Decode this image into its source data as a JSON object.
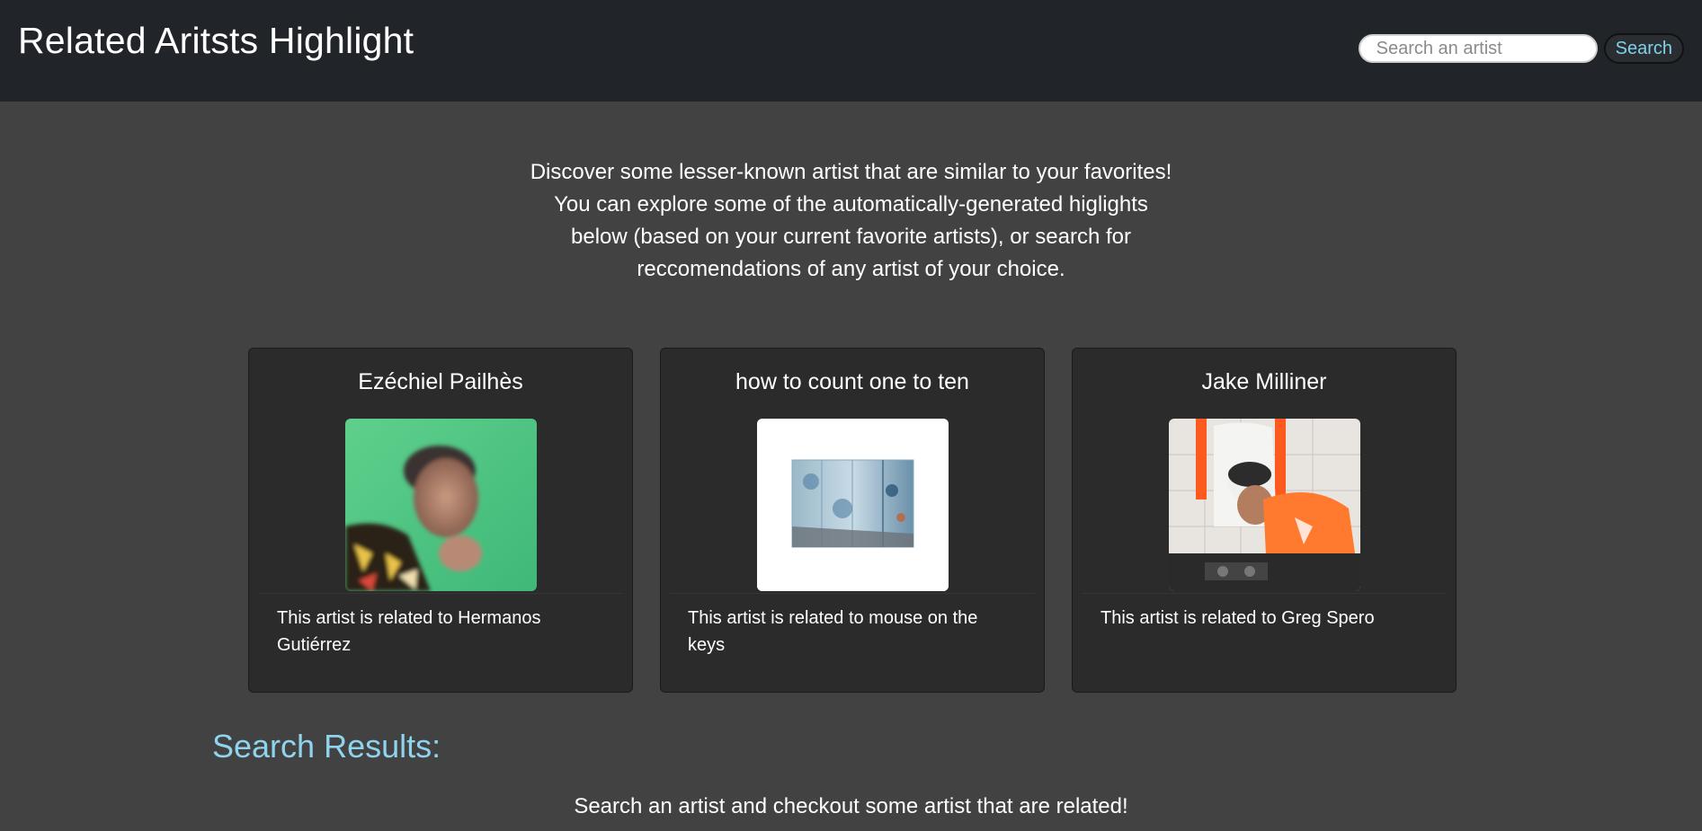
{
  "header": {
    "title": "Related Aritsts Highlight",
    "search_placeholder": "Search an artist",
    "search_button_label": "Search"
  },
  "intro": {
    "lines": [
      "Discover some lesser-known artist that are similar to your favorites!",
      "You can explore some of the automatically-generated higlights",
      "below (based on your current favorite artists), or search for",
      "reccomendations of any artist of your choice."
    ]
  },
  "cards": [
    {
      "artist": "Ezéchiel Pailhès",
      "related_text": "This artist is related to Hermanos Gutiérrez",
      "image": "artist-photo-portrait-green-background"
    },
    {
      "artist": "how to count one to ten",
      "related_text": "This artist is related to mouse on the keys",
      "image": "album-art-blue-wall"
    },
    {
      "artist": "Jake Milliner",
      "related_text": "This artist is related to Greg Spero",
      "image": "artist-photo-dj-orange-shirt"
    }
  ],
  "results": {
    "title": "Search Results:",
    "empty_message": "Search an artist and checkout some artist that are related!"
  },
  "colors": {
    "navbar": "#212529",
    "page_background": "#424242",
    "card_background": "#2b2b2b",
    "accent": "#8fd4ec"
  }
}
